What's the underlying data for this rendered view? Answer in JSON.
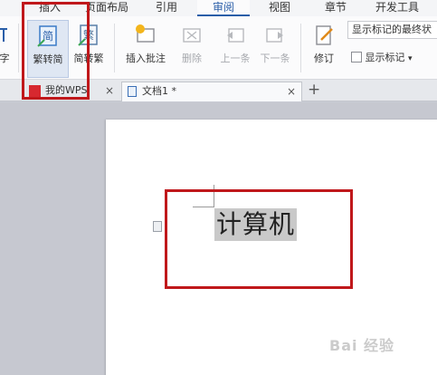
{
  "menu": {
    "tabs": [
      {
        "label": "插入"
      },
      {
        "label": "页面布局"
      },
      {
        "label": "引用"
      },
      {
        "label": "审阅"
      },
      {
        "label": "视图"
      },
      {
        "label": "章节"
      },
      {
        "label": "开发工具"
      }
    ]
  },
  "ribbon": {
    "left_partial": "字",
    "trad_to_simp": "繁转简",
    "simp_to_trad": "简转繁",
    "insert_comment": "插入批注",
    "delete": "删除",
    "prev": "上一条",
    "next": "下一条",
    "revise": "修订",
    "show_markup": "显示标记",
    "markup_mode": "显示标记的最终状"
  },
  "doc_tabs": {
    "wps_tab": "我的WPS",
    "doc_tab": "文档1 *"
  },
  "document": {
    "text": "计算机"
  },
  "watermark": "Bai 经验",
  "colors": {
    "accent": "#2a5ea8",
    "highlight": "#c0181b"
  }
}
